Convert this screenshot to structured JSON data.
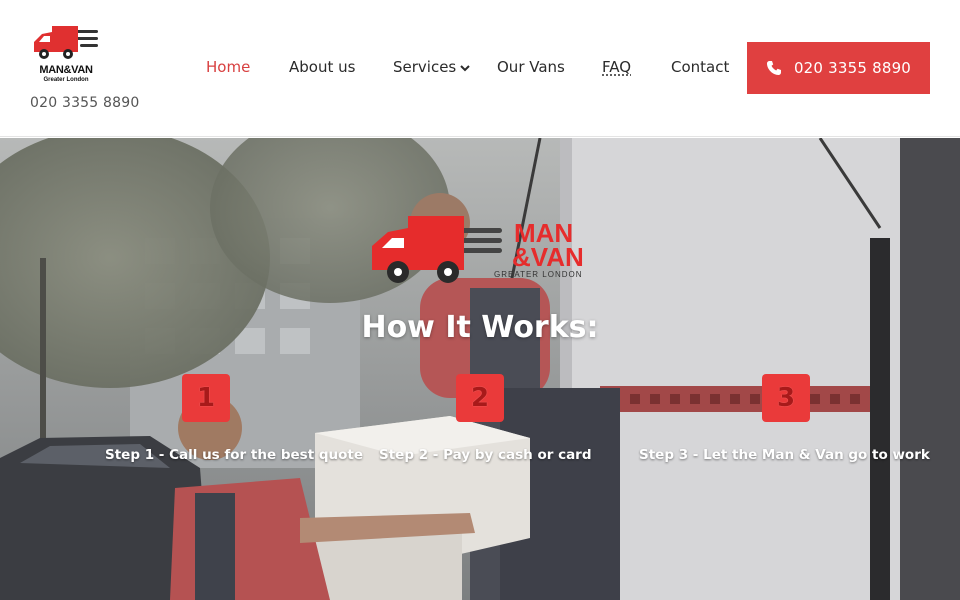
{
  "brand": {
    "logo_text_line1": "MAN&VAN",
    "logo_text_line2": "Greater London",
    "hero_logo_line1": "MAN",
    "hero_logo_line2": "& VAN",
    "hero_logo_line3": "GREATER LONDON",
    "accent_color": "#e04040"
  },
  "header": {
    "phone": "020 3355 8890"
  },
  "nav": {
    "items": [
      {
        "label": "Home",
        "active": true
      },
      {
        "label": "About us"
      },
      {
        "label": "Services",
        "has_dropdown": true
      },
      {
        "label": "Our Vans"
      },
      {
        "label": "FAQ"
      },
      {
        "label": "Contact"
      }
    ],
    "cta": {
      "label": "020 3355 8890",
      "icon": "phone-icon"
    }
  },
  "hero": {
    "title": "How It Works:",
    "steps": [
      {
        "number": "1",
        "text": "Step 1 - Call us for the best quote"
      },
      {
        "number": "2",
        "text": "Step 2 - Pay by cash or card"
      },
      {
        "number": "3",
        "text": "Step 3 - Let the Man & Van go to work"
      }
    ]
  }
}
